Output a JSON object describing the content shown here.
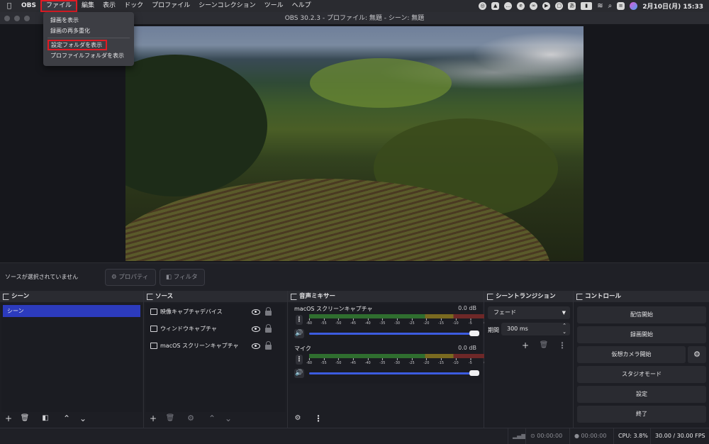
{
  "menubar": {
    "apple": "",
    "app": "OBS",
    "items": [
      "ファイル",
      "編集",
      "表示",
      "ドック",
      "プロファイル",
      "シーンコレクション",
      "ツール",
      "ヘルプ"
    ],
    "ime": "あ",
    "datetime": "2月10日(月)  15:33"
  },
  "file_menu": {
    "items": [
      "録画を表示",
      "録画の再多重化",
      "設定フォルダを表示",
      "プロファイルフォルダを表示"
    ]
  },
  "window": {
    "title": "OBS 30.2.3 - プロファイル: 無題 - シーン: 無題"
  },
  "source_bar": {
    "no_source": "ソースが選択されていません",
    "properties": "プロパティ",
    "filters": "フィルタ"
  },
  "scenes": {
    "title": "シーン",
    "items": [
      "シーン"
    ]
  },
  "sources": {
    "title": "ソース",
    "items": [
      "映像キャプチャデバイス",
      "ウィンドウキャプチャ",
      "macOS スクリーンキャプチャ"
    ]
  },
  "mixer": {
    "title": "音声ミキサー",
    "ticks": [
      "-60",
      "-55",
      "-50",
      "-45",
      "-40",
      "-35",
      "-30",
      "-25",
      "-20",
      "-15",
      "-10",
      "-5",
      "0"
    ],
    "channels": [
      {
        "name": "macOS スクリーンキャプチャ",
        "db": "0.0 dB"
      },
      {
        "name": "マイク",
        "db": "0.0 dB"
      }
    ]
  },
  "transitions": {
    "title": "シーントランジション",
    "type": "フェード",
    "duration_label": "期間",
    "duration": "300 ms"
  },
  "controls": {
    "title": "コントロール",
    "buttons": [
      "配信開始",
      "録画開始",
      "仮想カメラ開始",
      "スタジオモード",
      "設定",
      "終了"
    ]
  },
  "status": {
    "stream_time": "00:00:00",
    "rec_time": "00:00:00",
    "cpu": "CPU: 3.8%",
    "fps": "30.00 / 30.00 FPS"
  }
}
